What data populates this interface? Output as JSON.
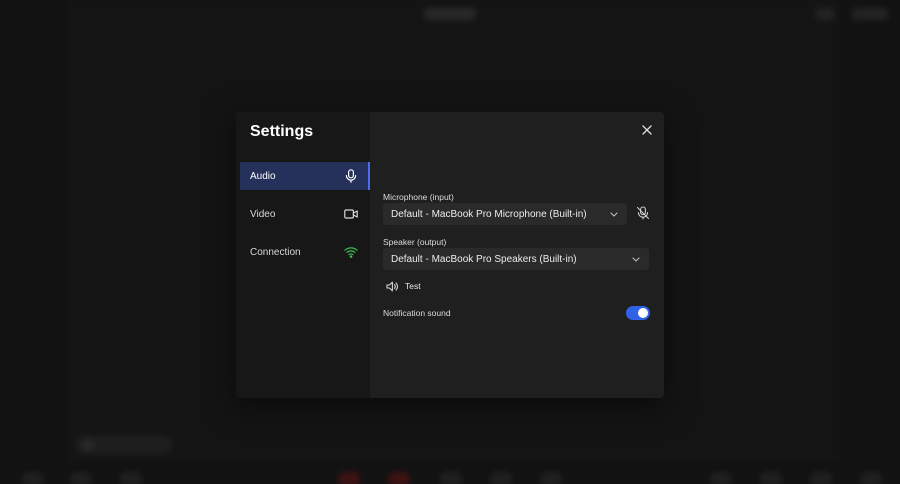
{
  "settings": {
    "title": "Settings",
    "nav": [
      {
        "label": "Audio",
        "icon": "microphone-icon",
        "active": true
      },
      {
        "label": "Video",
        "icon": "video-camera-icon",
        "active": false
      },
      {
        "label": "Connection",
        "icon": "wifi-icon",
        "active": false
      }
    ],
    "audio": {
      "microphone_label": "Microphone (input)",
      "microphone_value": "Default - MacBook Pro Microphone (Built-in)",
      "speaker_label": "Speaker (output)",
      "speaker_value": "Default - MacBook Pro Speakers (Built-in)",
      "test_label": "Test",
      "notification_label": "Notification sound",
      "notification_on": true
    }
  },
  "colors": {
    "accent": "#2f62e6",
    "active_nav_bg": "#25315a",
    "connection_good": "#3fb950"
  }
}
